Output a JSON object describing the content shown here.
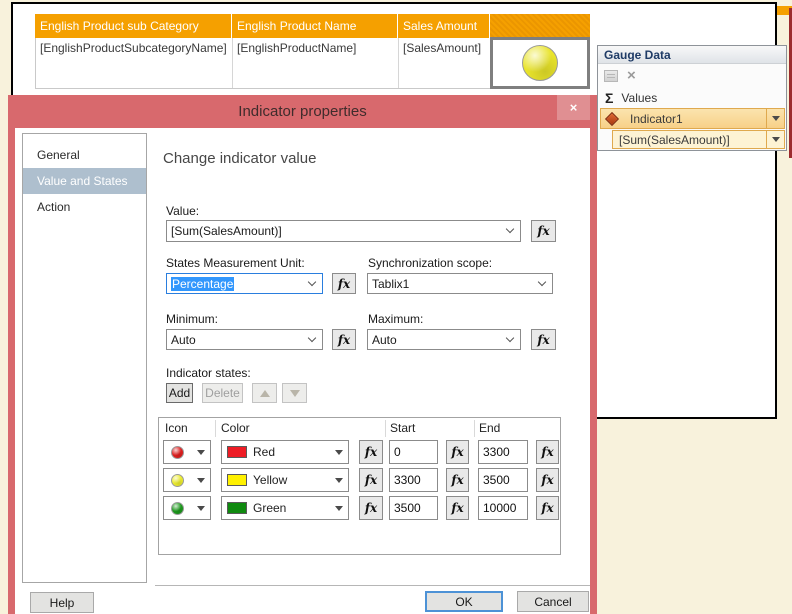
{
  "icons": {
    "close": "×",
    "delete": "×",
    "sigma": "Σ"
  },
  "colors": {
    "dialog_titlebar": "#d8696d",
    "table_header_orange": "#f5a000",
    "selection_blue": "#3297fd",
    "nav_selected": "#aebfce"
  },
  "report_table": {
    "headers": [
      "English Product sub Category",
      "English Product Name",
      "Sales Amount",
      ""
    ],
    "row": [
      "[EnglishProductSubcategoryName]",
      "[EnglishProductName]",
      "[SalesAmount]"
    ],
    "indicator_color": "#e9e42b"
  },
  "gauge_panel": {
    "title": "Gauge Data",
    "values_label": "Values",
    "indicator": {
      "name": "Indicator1",
      "value": "[Sum(SalesAmount)]"
    }
  },
  "dialog": {
    "title": "Indicator properties",
    "nav": [
      {
        "label": "General"
      },
      {
        "label": "Value and States"
      },
      {
        "label": "Action"
      }
    ],
    "heading": "Change indicator value",
    "fields": {
      "value_label": "Value:",
      "value": "[Sum(SalesAmount)]",
      "smu_label": "States Measurement Unit:",
      "smu": "Percentage",
      "sync_label": "Synchronization scope:",
      "sync": "Tablix1",
      "min_label": "Minimum:",
      "min": "Auto",
      "max_label": "Maximum:",
      "max": "Auto"
    },
    "states": {
      "label": "Indicator states:",
      "add": "Add",
      "delete": "Delete",
      "headers": [
        "Icon",
        "Color",
        "Start",
        "End"
      ],
      "rows": [
        {
          "icon": "#e01f1f",
          "name": "Red",
          "swatch": "#ee1c25",
          "start": "0",
          "end": "3300"
        },
        {
          "icon": "#eded2e",
          "name": "Yellow",
          "swatch": "#fff100",
          "start": "3300",
          "end": "3500"
        },
        {
          "icon": "#1d9a1d",
          "name": "Green",
          "swatch": "#0f8a0f",
          "start": "3500",
          "end": "10000"
        }
      ]
    },
    "fx": "fx",
    "help": "Help",
    "ok": "OK",
    "cancel": "Cancel"
  }
}
